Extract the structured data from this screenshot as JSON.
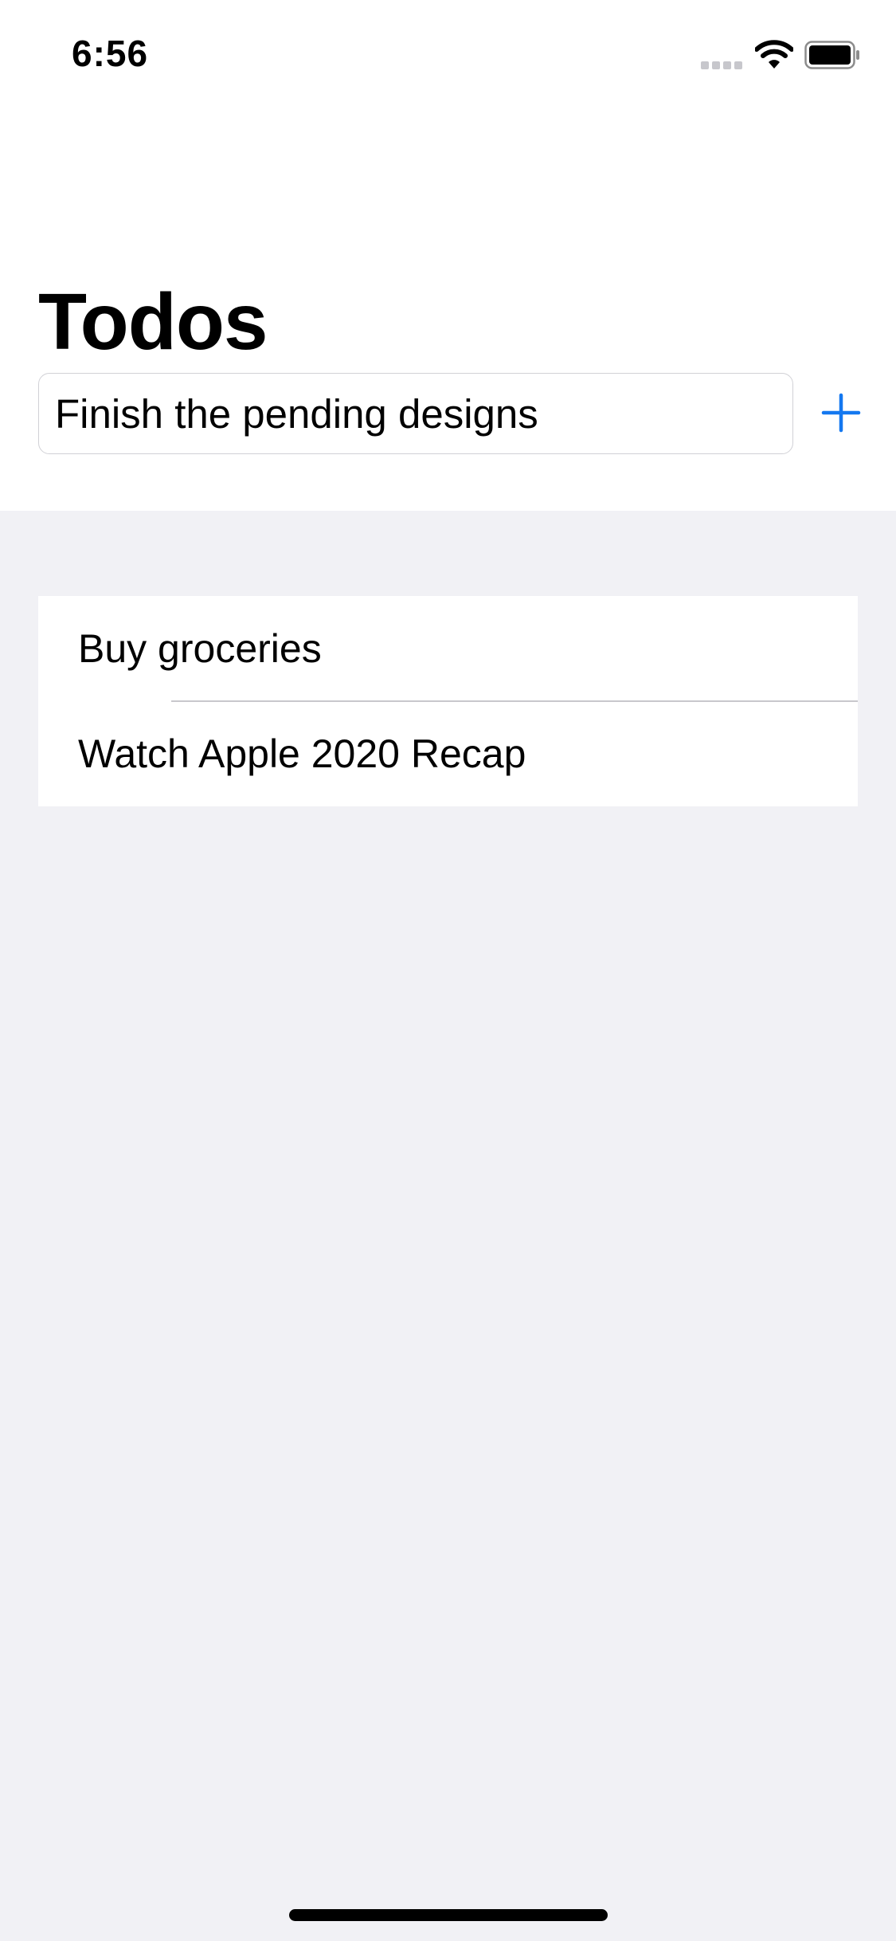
{
  "status_bar": {
    "time": "6:56",
    "icons": [
      "cellular-signal-icon",
      "wifi-icon",
      "battery-icon"
    ]
  },
  "page": {
    "title": "Todos"
  },
  "new_todo": {
    "value": "Finish the pending designs",
    "add_icon": "plus-icon"
  },
  "todos": [
    {
      "label": "Buy groceries"
    },
    {
      "label": "Watch Apple 2020 Recap"
    }
  ],
  "colors": {
    "accent": "#1478f0",
    "background": "#f1f1f5",
    "separator": "#c8c7cc"
  }
}
